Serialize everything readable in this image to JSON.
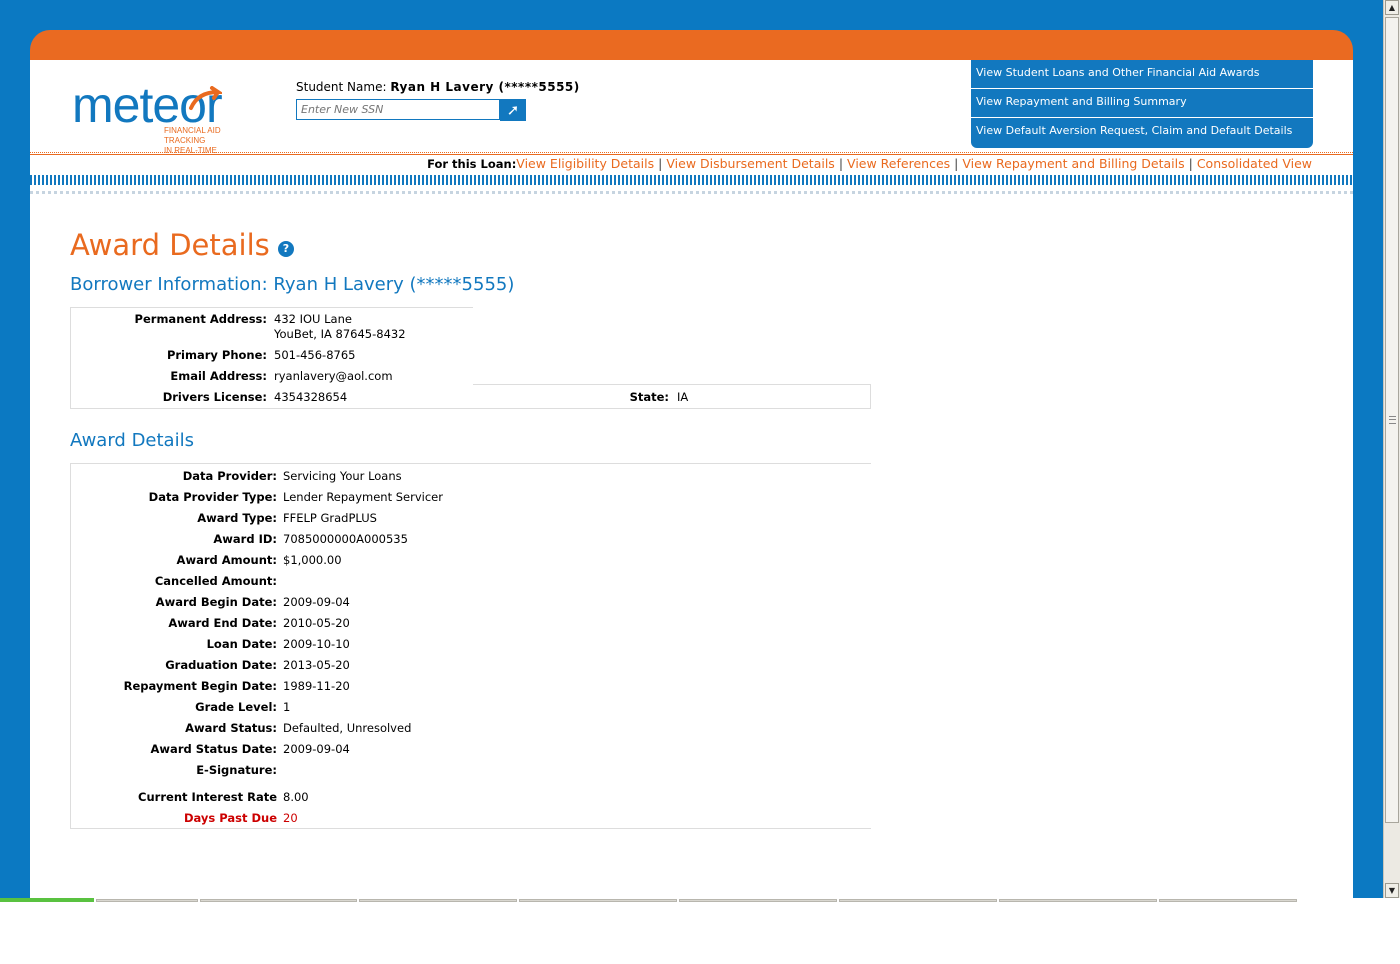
{
  "logo": {
    "word": "meteor",
    "tagline_line1": "FINANCIAL AID TRACKING",
    "tagline_line2": "IN REAL-TIME"
  },
  "student": {
    "label": "Student Name:",
    "name": "Ryan H Lavery (*****5555)"
  },
  "ssn_input": {
    "placeholder": "Enter New SSN",
    "go_icon": "arrow-icon"
  },
  "top_menu": [
    "View Student Loans and Other Financial Aid Awards",
    "View Repayment and Billing Summary",
    "View Default Aversion Request, Claim and Default Details"
  ],
  "loan_nav": {
    "label": "For this Loan:",
    "links": [
      "View Eligibility Details",
      "View Disbursement Details",
      "View References",
      "View Repayment and Billing Details",
      "Consolidated View"
    ],
    "separator": "|"
  },
  "page_title": "Award Details",
  "help_icon": "?",
  "borrower": {
    "heading": "Borrower Information: Ryan H Lavery (*****5555)",
    "permanent_address_label": "Permanent Address:",
    "address_line1": "432 IOU Lane",
    "address_line2": "YouBet, IA 87645-8432",
    "phone_label": "Primary Phone:",
    "phone": "501-456-8765",
    "email_label": "Email Address:",
    "email": "ryanlavery@aol.com",
    "license_label": "Drivers License:",
    "license": "4354328654",
    "state_label": "State:",
    "state": "IA"
  },
  "award": {
    "heading": "Award Details",
    "rows": [
      {
        "label": "Data Provider:",
        "value": "Servicing Your Loans"
      },
      {
        "label": "Data Provider Type:",
        "value": "Lender Repayment Servicer"
      },
      {
        "label": "Award Type:",
        "value": "FFELP GradPLUS"
      },
      {
        "label": "Award ID:",
        "value": "7085000000A000535"
      },
      {
        "label": "Award Amount:",
        "value": "$1,000.00"
      },
      {
        "label": "Cancelled Amount:",
        "value": ""
      },
      {
        "label": "Award Begin Date:",
        "value": "2009-09-04"
      },
      {
        "label": "Award End Date:",
        "value": "2010-05-20"
      },
      {
        "label": "Loan Date:",
        "value": "2009-10-10"
      },
      {
        "label": "Graduation Date:",
        "value": "2013-05-20"
      },
      {
        "label": "Repayment Begin Date:",
        "value": "1989-11-20"
      },
      {
        "label": "Grade Level:",
        "value": "1"
      },
      {
        "label": "Award Status:",
        "value": "Defaulted, Unresolved"
      },
      {
        "label": "Award Status Date:",
        "value": "2009-09-04"
      },
      {
        "label": "E-Signature:",
        "value": ""
      }
    ],
    "interest_label": "Current Interest Rate",
    "interest_value": "8.00",
    "days_past_due_label": "Days Past Due",
    "days_past_due_value": "20"
  },
  "colors": {
    "brand_blue": "#1278bf",
    "brand_orange": "#e96a1f",
    "alert_red": "#cc0000"
  }
}
